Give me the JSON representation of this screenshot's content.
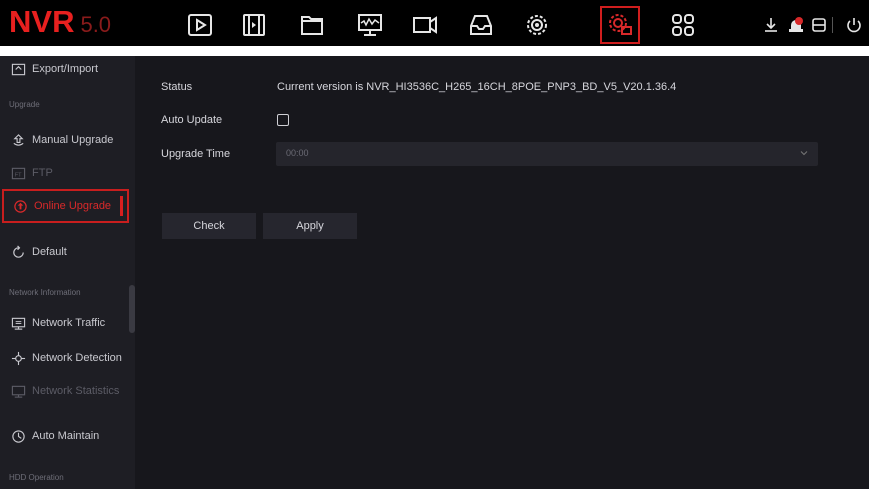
{
  "app": {
    "logo_main": "NVR",
    "logo_version": "5.0"
  },
  "top_nav": {
    "icons": [
      "playback-icon",
      "video-clip-icon",
      "folder-icon",
      "monitor-wave-icon",
      "camera-icon",
      "storage-icon",
      "settings-icon",
      "system-settings-icon",
      "apps-grid-icon"
    ],
    "active": "system-settings-icon",
    "right_icons": [
      "download-icon",
      "alarm-icon",
      "record-icon",
      "power-icon"
    ]
  },
  "sidebar": {
    "items": [
      {
        "label": "Export/Import",
        "icon": "export-icon",
        "state": "normal"
      },
      {
        "section": "Upgrade"
      },
      {
        "label": "Manual Upgrade",
        "icon": "manual-upgrade-icon",
        "state": "normal"
      },
      {
        "label": "FTP",
        "icon": "ftp-icon",
        "state": "dim"
      },
      {
        "label": "Online Upgrade",
        "icon": "online-upgrade-icon",
        "state": "active"
      },
      {
        "label": "Default",
        "icon": "default-icon",
        "state": "normal"
      },
      {
        "section": "Network Information"
      },
      {
        "label": "Network Traffic",
        "icon": "network-traffic-icon",
        "state": "normal"
      },
      {
        "label": "Network Detection",
        "icon": "network-detection-icon",
        "state": "normal"
      },
      {
        "label": "Network Statistics",
        "icon": "network-statistics-icon",
        "state": "dim"
      },
      {
        "label": "Auto Maintain",
        "icon": "auto-maintain-icon",
        "state": "normal"
      },
      {
        "section": "HDD Operation"
      }
    ]
  },
  "form": {
    "status_label": "Status",
    "status_value": "Current version is NVR_HI3536C_H265_16CH_8POE_PNP3_BD_V5_V20.1.36.4",
    "auto_update_label": "Auto Update",
    "auto_update_checked": false,
    "upgrade_time_label": "Upgrade Time",
    "upgrade_time_value": "00:00"
  },
  "buttons": {
    "check": "Check",
    "apply": "Apply"
  },
  "colors": {
    "accent": "#d8292a",
    "background": "#17171c",
    "sidebar": "#1e1e24",
    "topbar": "#000000"
  }
}
